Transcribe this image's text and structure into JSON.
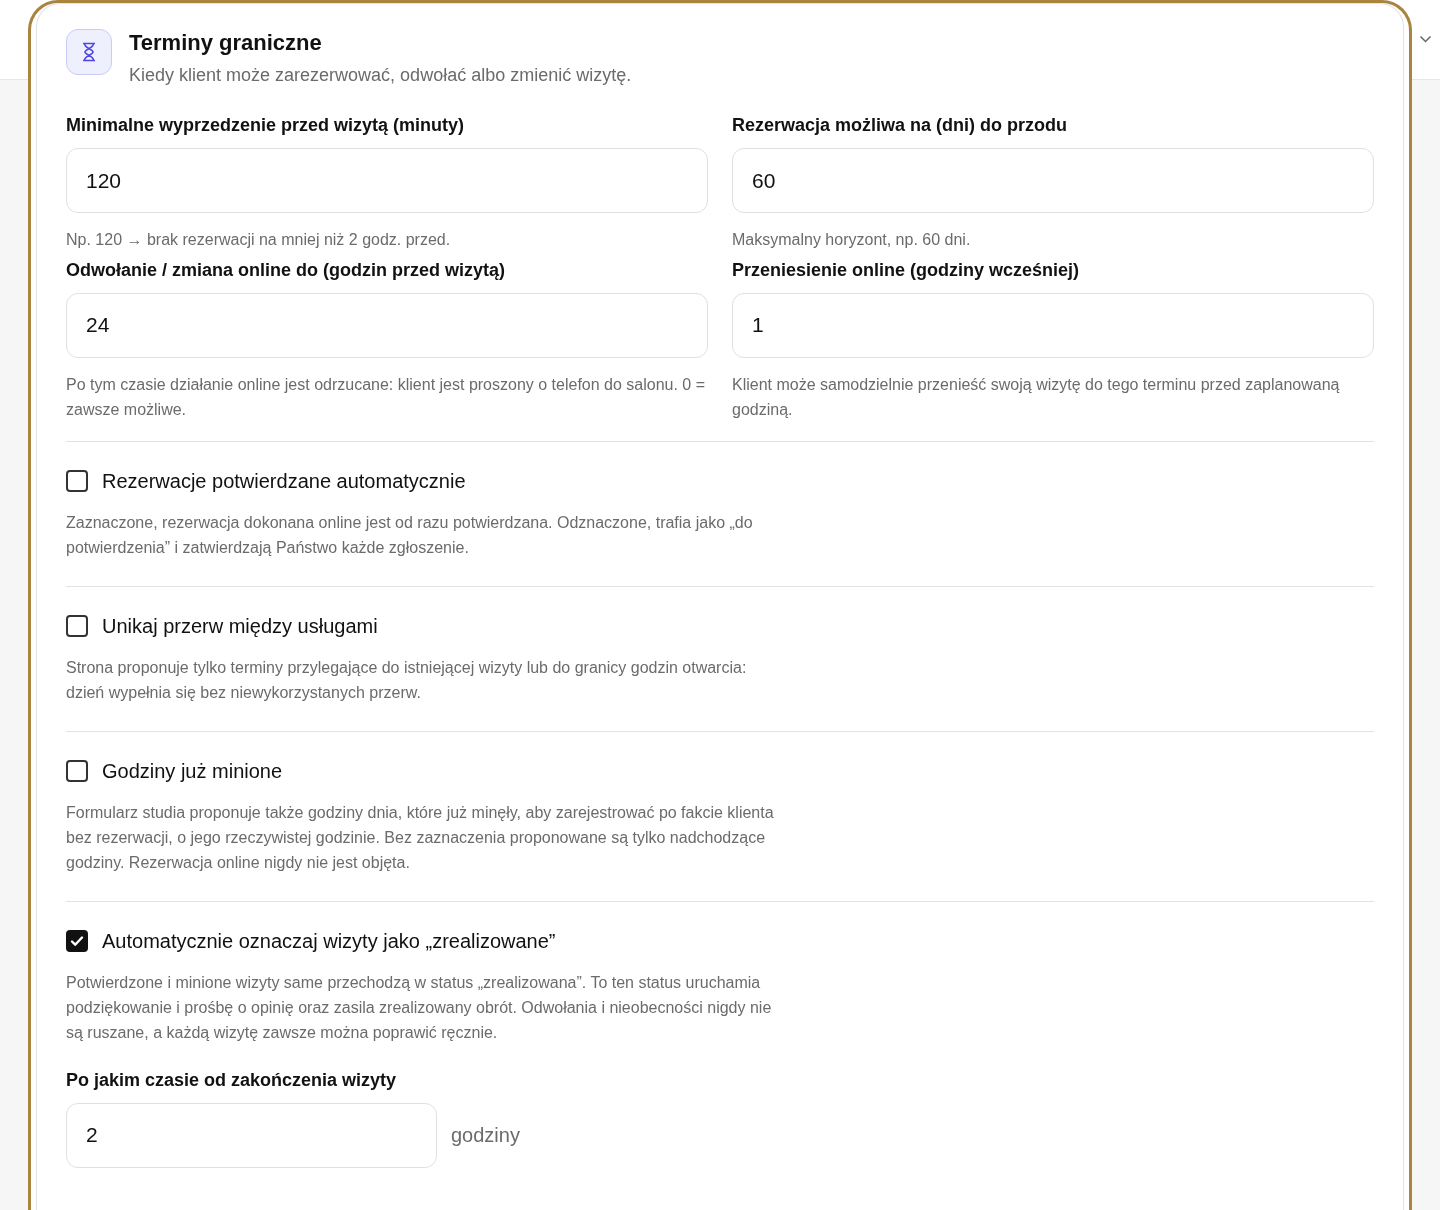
{
  "header": {
    "title": "Terminy graniczne",
    "subtitle": "Kiedy klient może zarezerwować, odwołać albo zmienić wizytę."
  },
  "fields": [
    {
      "label": "Minimalne wyprzedzenie przed wizytą (minuty)",
      "value": "120",
      "hint": "Np. 120 → brak rezerwacji na mniej niż 2 godz. przed."
    },
    {
      "label": "Rezerwacja możliwa na (dni) do przodu",
      "value": "60",
      "hint": "Maksymalny horyzont, np. 60 dni."
    },
    {
      "label": "Odwołanie / zmiana online do (godzin przed wizytą)",
      "value": "24",
      "hint": "Po tym czasie działanie online jest odrzucane: klient jest proszony o telefon do salonu. 0 = zawsze możliwe."
    },
    {
      "label": "Przeniesienie online (godziny wcześniej)",
      "value": "1",
      "hint": "Klient może samodzielnie przenieść swoją wizytę do tego terminu przed zaplanowaną godziną."
    }
  ],
  "options": [
    {
      "label": "Rezerwacje potwierdzane automatycznie",
      "checked": false,
      "description": "Zaznaczone, rezerwacja dokonana online jest od razu potwierdzana. Odznaczone, trafia jako „do potwierdzenia” i zatwierdzają Państwo każde zgłoszenie."
    },
    {
      "label": "Unikaj przerw między usługami",
      "checked": false,
      "description": "Strona proponuje tylko terminy przylegające do istniejącej wizyty lub do granicy godzin otwarcia: dzień wypełnia się bez niewykorzystanych przerw."
    },
    {
      "label": "Godziny już minione",
      "checked": false,
      "description": "Formularz studia proponuje także godziny dnia, które już minęły, aby zarejestrować po fakcie klienta bez rezerwacji, o jego rzeczywistej godzinie. Bez zaznaczenia proponowane są tylko nadchodzące godziny. Rezerwacja online nigdy nie jest objęta."
    },
    {
      "label": "Automatycznie oznaczaj wizyty jako „zrealizowane”",
      "checked": true,
      "description": "Potwierdzone i minione wizyty same przechodzą w status „zrealizowana”. To ten status uruchamia podziękowanie i prośbę o opinię oraz zasila zrealizowany obrót. Odwołania i nieobecności nigdy nie są ruszane, a każdą wizytę zawsze można poprawić ręcznie."
    }
  ],
  "delay": {
    "label": "Po jakim czasie od zakończenia wizyty",
    "value": "2",
    "unit": "godziny"
  }
}
